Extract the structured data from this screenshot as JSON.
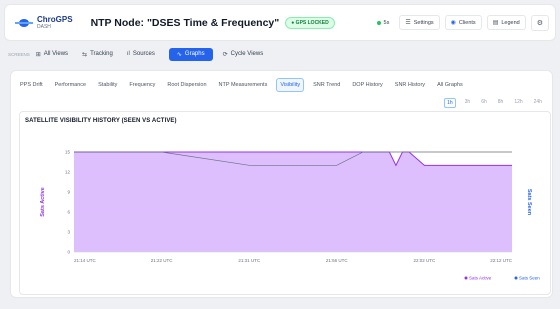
{
  "header": {
    "logo_name": "ChroGPS",
    "logo_sub": "DASH",
    "title": "NTP Node: \"DSES Time & Frequency\"",
    "gps_badge": "● GPS LOCKED",
    "live_label": "5s",
    "settings_label": "Settings",
    "clients_label": "Clients",
    "legend_label": "Legend"
  },
  "viewbar": {
    "label": "SCREENS",
    "items": [
      "All Views",
      "Tracking",
      "Sources",
      "Graphs",
      "Cycle Views"
    ],
    "active_index": 3
  },
  "tabs": {
    "items": [
      "PPS Drift",
      "Performance",
      "Stability",
      "Frequency",
      "Root Dispersion",
      "NTP Measurements",
      "Visibility",
      "SNR Trend",
      "DOP History",
      "SNR History",
      "All Graphs"
    ],
    "active_index": 6
  },
  "ranges": {
    "items": [
      "1h",
      "3h",
      "6h",
      "8h",
      "12h",
      "24h"
    ],
    "active_index": 0
  },
  "colors": {
    "accent": "#2563eb",
    "sats_active": "#9333ea",
    "sats_seen": "#2563eb",
    "fill": "#d8b4fe"
  },
  "chart_data": {
    "type": "area",
    "title": "SATELLITE VISIBILITY HISTORY (SEEN VS ACTIVE)",
    "ylabel_left": "Sats Active",
    "ylabel_right": "Sats Seen",
    "ylim": [
      0,
      15
    ],
    "yticks": [
      "0",
      "3",
      "6",
      "9",
      "12",
      "15"
    ],
    "x": [
      0,
      10,
      20,
      40,
      52,
      60,
      66,
      68,
      70,
      72,
      73.5,
      75,
      76.5,
      80,
      100
    ],
    "xtick_positions": [
      0,
      20,
      40,
      60,
      80,
      100
    ],
    "xtick_labels": [
      "21:14 UTC",
      "21:22 UTC",
      "21:31 UTC",
      "21:56 UTC",
      "22:02 UTC",
      "22:12 UTC"
    ],
    "series": [
      {
        "name": "Sats Active",
        "values": [
          15,
          15,
          15,
          15,
          15,
          15,
          15,
          15,
          15,
          15,
          13,
          15,
          15,
          13,
          13
        ]
      },
      {
        "name": "Sats Seen",
        "values": [
          15,
          15,
          15,
          13,
          13,
          13,
          15,
          15,
          15,
          15,
          15,
          15,
          15,
          15,
          15
        ]
      }
    ],
    "grid": true,
    "legend": [
      "Sats Active",
      "Sats Seen"
    ],
    "legend_position": "bottom-right"
  }
}
